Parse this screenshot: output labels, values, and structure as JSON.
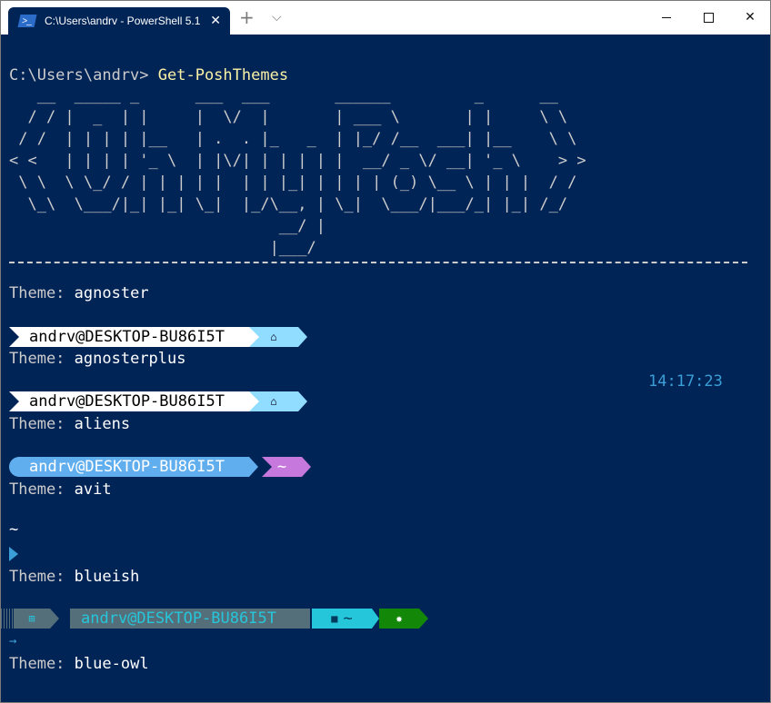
{
  "window": {
    "tab_title": "C:\\Users\\andrv - PowerShell 5.1",
    "tab_icon": "powershell-icon",
    "close_tab_icon": "close-icon",
    "new_tab_icon": "plus-icon",
    "dropdown_icon": "chevron-down-icon",
    "minimize_icon": "minimize-icon",
    "maximize_icon": "maximize-icon",
    "close_icon": "close-icon"
  },
  "colors": {
    "background": "#012456",
    "agnoster_user_bg": "#ffffff",
    "agnoster_path_bg": "#91ddff",
    "aliens_user_bg": "#61aeee",
    "aliens_path_bg": "#c678dd",
    "blueish_user_bg": "#546e7a",
    "blueish_path_bg": "#26c6da",
    "blueish_status_bg": "#138808",
    "clock": "#3b9ed6"
  },
  "terminal": {
    "prompt": "C:\\Users\\andrv> ",
    "command": "Get-PoshThemes",
    "ascii_art": "   __  _____ _      ___  ___       ______         _      __\n  / / |  _  | |     |  \\/  |       | ___ \\       | |     \\ \\\n / /  | | | | |__   | .  . |_   _  | |_/ /__  ___| |__    \\ \\\n< <   | | | | '_ \\  | |\\/| | | | | |  __/ _ \\/ __| '_ \\    > >\n \\ \\  \\ \\_/ / | | | | |  | | |_| | | | | (_) \\__ \\ | | |  / /\n  \\_\\  \\___/|_| |_| \\_|  |_/\\__, | \\_|  \\___/|___/_| |_| /_/\n                             __/ |\n                            |___/",
    "clock": "14:17:23",
    "theme_label": "Theme:",
    "themes": [
      {
        "name": "agnoster",
        "user": "andrv@DESKTOP-BU86I5T",
        "path_glyph": "⌂"
      },
      {
        "name": "agnosterplus",
        "user": "andrv@DESKTOP-BU86I5T",
        "path_glyph": "⌂"
      },
      {
        "name": "aliens",
        "user": "andrv@DESKTOP-BU86I5T",
        "path_glyph": "~"
      },
      {
        "name": "avit",
        "path": "~"
      },
      {
        "name": "blueish",
        "user": "andrv@DESKTOP-BU86I5T",
        "path_glyph": "~",
        "arrow": "→"
      },
      {
        "name": "blue-owl"
      }
    ]
  }
}
